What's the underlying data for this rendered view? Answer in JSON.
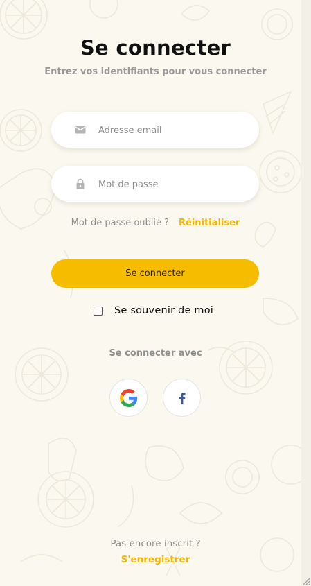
{
  "header": {
    "title": "Se connecter",
    "subtitle": "Entrez vos identifiants pour vous connecter"
  },
  "form": {
    "email": {
      "placeholder": "Adresse email",
      "value": ""
    },
    "password": {
      "placeholder": "Mot de passe",
      "value": ""
    },
    "forgot_text": "Mot de passe oublié ?",
    "reset_label": "Réinitialiser",
    "submit_label": "Se connecter",
    "remember_label": "Se souvenir de moi",
    "remember_checked": false
  },
  "social": {
    "title": "Se connecter avec",
    "providers": [
      {
        "name": "google",
        "icon": "google-icon"
      },
      {
        "name": "facebook",
        "icon": "facebook-icon"
      }
    ]
  },
  "footer": {
    "question": "Pas encore inscrit ?",
    "register_label": "S'enregistrer"
  },
  "colors": {
    "background": "#fbf9ef",
    "accent": "#f6bd00",
    "link": "#f4b400",
    "muted_text": "#8e8e8e"
  }
}
